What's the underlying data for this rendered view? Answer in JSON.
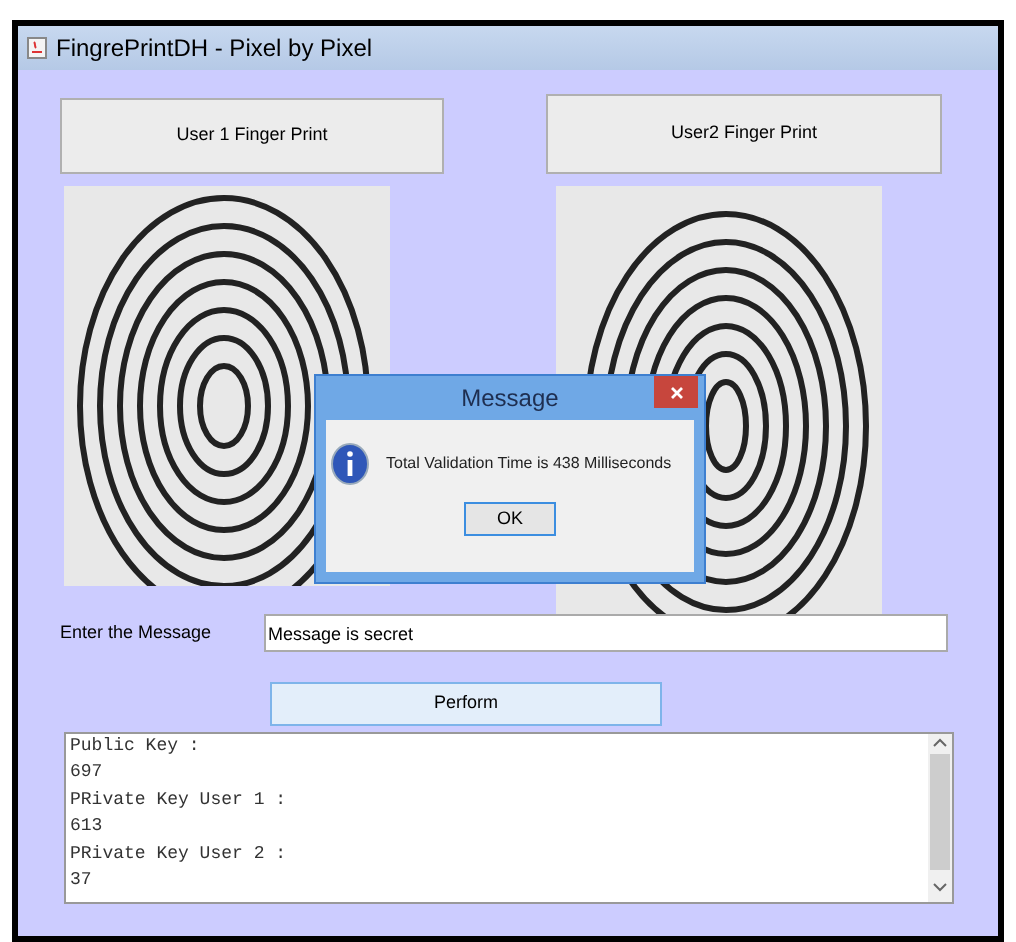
{
  "window": {
    "title": "FingrePrintDH - Pixel by Pixel"
  },
  "buttons": [
    {
      "label": "User 1 Finger Print"
    },
    {
      "label": "User2 Finger Print"
    }
  ],
  "message_field": {
    "label": "Enter the Message",
    "value": "Message is secret"
  },
  "perform_button": {
    "label": "Perform"
  },
  "output_lines": [
    "Public Key :",
    "697",
    "PRivate Key User 1 :",
    "613",
    "PRivate Key User 2 :",
    "37"
  ],
  "dialog": {
    "title": "Message",
    "text": "Total Validation Time is 438 Milliseconds",
    "ok": "OK"
  }
}
